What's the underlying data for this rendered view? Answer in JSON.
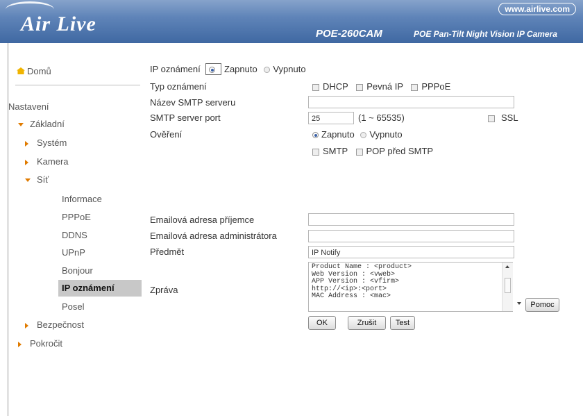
{
  "header": {
    "logo": "Air Live",
    "site": "www.airlive.com",
    "model": "POE-260CAM",
    "description": "POE Pan-Tilt Night Vision IP Camera"
  },
  "sidebar": {
    "home": "Domů",
    "settings": "Nastavení",
    "basic": "Základní",
    "system": "Systém",
    "camera": "Kamera",
    "network": "Síť",
    "network_items": [
      "Informace",
      "PPPoE",
      "DDNS",
      "UPnP",
      "Bonjour",
      "IP oznámení",
      "Posel"
    ],
    "security": "Bezpečnost",
    "advanced": "Pokročit"
  },
  "form": {
    "ip_notify_label": "IP oznámení",
    "on": "Zapnuto",
    "off": "Vypnuto",
    "notify_type_label": "Typ oznámení",
    "dhcp": "DHCP",
    "static_ip": "Pevná IP",
    "pppoe": "PPPoE",
    "smtp_server_label": "Název SMTP serveru",
    "smtp_server_value": "",
    "smtp_port_label": "SMTP server port",
    "smtp_port_value": "25",
    "port_range": "(1 ~ 65535)",
    "ssl": "SSL",
    "auth_label": "Ověření",
    "auth_on": "Zapnuto",
    "auth_off": "Vypnuto",
    "smtp": "SMTP",
    "pop_before_smtp": "POP před SMTP",
    "recipient_label": "Emailová adresa příjemce",
    "recipient_value": "",
    "admin_label": "Emailová adresa administrátora",
    "admin_value": "",
    "subject_label": "Předmět",
    "subject_value": "IP Notify",
    "message_label": "Zpráva",
    "message_value": "Product Name : <product>\nWeb Version : <vweb>\nAPP Version : <vfirm>\nhttp://<ip>:<port>\nMAC Address : <mac>",
    "help_button": "Pomoc",
    "ok_button": "OK",
    "cancel_button": "Zrušit",
    "test_button": "Test"
  }
}
